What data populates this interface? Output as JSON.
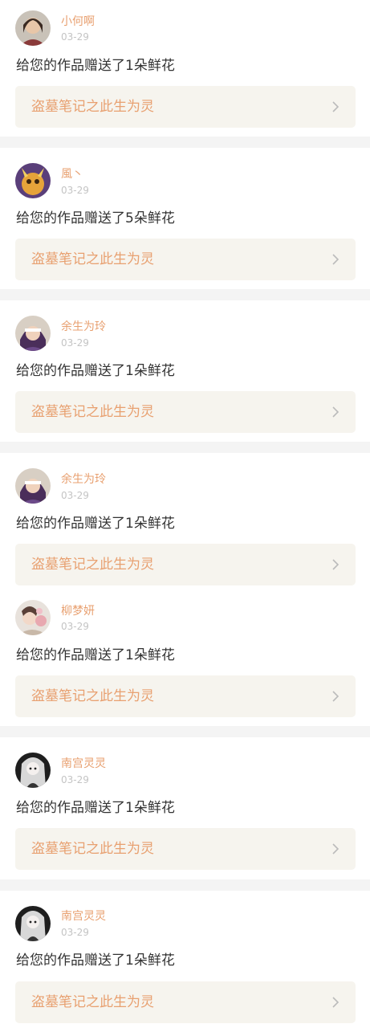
{
  "colors": {
    "accent": "#e8a070",
    "date": "#c4c4c4",
    "text": "#333333",
    "link_bg": "#f6f4ee",
    "separator": "#f4f4f4"
  },
  "icons": {
    "chevron": "chevron-right-icon"
  },
  "items": [
    {
      "username": "小何啊",
      "date": "03-29",
      "message": "给您的作品赠送了1朵鲜花",
      "work_title": "盗墓笔记之此生为灵"
    },
    {
      "username": "風丶",
      "date": "03-29",
      "message": "给您的作品赠送了5朵鲜花",
      "work_title": "盗墓笔记之此生为灵"
    },
    {
      "username": "余生为玲",
      "date": "03-29",
      "message": "给您的作品赠送了1朵鲜花",
      "work_title": "盗墓笔记之此生为灵"
    },
    {
      "username": "余生为玲",
      "date": "03-29",
      "message": "给您的作品赠送了1朵鲜花",
      "work_title": "盗墓笔记之此生为灵"
    },
    {
      "username": "柳梦妍",
      "date": "03-29",
      "message": "给您的作品赠送了1朵鲜花",
      "work_title": "盗墓笔记之此生为灵"
    },
    {
      "username": "南宫灵灵",
      "date": "03-29",
      "message": "给您的作品赠送了1朵鲜花",
      "work_title": "盗墓笔记之此生为灵"
    },
    {
      "username": "南宫灵灵",
      "date": "03-29",
      "message": "给您的作品赠送了1朵鲜花",
      "work_title": "盗墓笔记之此生为灵"
    }
  ]
}
